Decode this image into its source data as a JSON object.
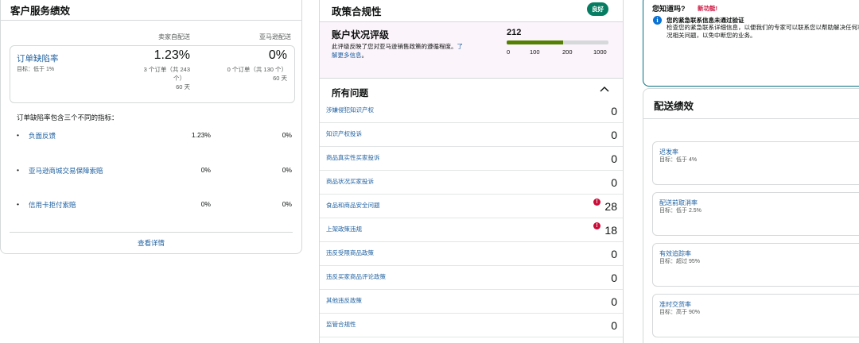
{
  "customer_service": {
    "title": "客户服务绩效",
    "col_fbm": "卖家自配送",
    "col_fba": "亚马逊配送",
    "odr": {
      "name": "订单缺陷率",
      "target": "目标：低于 1%",
      "fbm_value": "1.23%",
      "fbm_line1": "3 个订单（共 243",
      "fbm_line2": "个）",
      "fbm_period": "60 天",
      "fba_value": "0%",
      "fba_line1": "0 个订单（共 130 个）",
      "fba_period": "60 天"
    },
    "description": "订单缺陷率包含三个不同的指标：",
    "metrics": [
      {
        "name": "负面反馈",
        "fbm": "1.23%",
        "fba": "0%"
      },
      {
        "name": "亚马逊商城交易保障索赔",
        "fbm": "0%",
        "fba": "0%"
      },
      {
        "name": "信用卡拒付索赔",
        "fbm": "0%",
        "fba": "0%"
      }
    ],
    "bullet": "•",
    "details_link": "查看详情"
  },
  "policy": {
    "title": "政策合规性",
    "badge": "良好",
    "ahr": {
      "title": "账户状况评级",
      "desc_text": "此评级反映了您对亚马逊销售政策的遵循程度。",
      "desc_link1": "了",
      "desc_link2": "解更多信息",
      "desc_end": "。",
      "score": "212",
      "score_max": 1000,
      "ticks": [
        "0",
        "100",
        "200",
        "1000"
      ],
      "status_color": "#538000"
    },
    "issues_title": "所有问题",
    "issues": [
      {
        "name": "涉嫌侵犯知识产权",
        "count": "0",
        "alert": false
      },
      {
        "name": "知识产权投诉",
        "count": "0",
        "alert": false
      },
      {
        "name": "商品真实性买家投诉",
        "count": "0",
        "alert": false
      },
      {
        "name": "商品状况买家投诉",
        "count": "0",
        "alert": false
      },
      {
        "name": "食品和商品安全问题",
        "count": "28",
        "alert": true
      },
      {
        "name": "上架政策违规",
        "count": "18",
        "alert": true
      },
      {
        "name": "违反受限商品政策",
        "count": "0",
        "alert": false
      },
      {
        "name": "违反买家商品评论政策",
        "count": "0",
        "alert": false
      },
      {
        "name": "其他违反政策",
        "count": "0",
        "alert": false
      },
      {
        "name": "监管合规性",
        "count": "0",
        "alert": false
      }
    ],
    "alert_glyph": "!"
  },
  "did_you_know": {
    "question": "您知道吗?",
    "new_label": "新功能!",
    "info_glyph": "i",
    "info_title": "您的紧急联系信息未通过验证",
    "info_desc": "检查您的紧急联系详细信息，以便我们的专家可以联系您以帮助解决任何状况相关问题，以免中断您的业务。"
  },
  "shipping": {
    "title": "配送绩效",
    "metrics": [
      {
        "name": "迟发率",
        "target": "目标：低于 4%"
      },
      {
        "name": "配送前取消率",
        "target": "目标：低于 2.5%"
      },
      {
        "name": "有效追踪率",
        "target": "目标：超过 95%"
      },
      {
        "name": "准时交货率",
        "target": "目标：高于 90%"
      }
    ]
  }
}
